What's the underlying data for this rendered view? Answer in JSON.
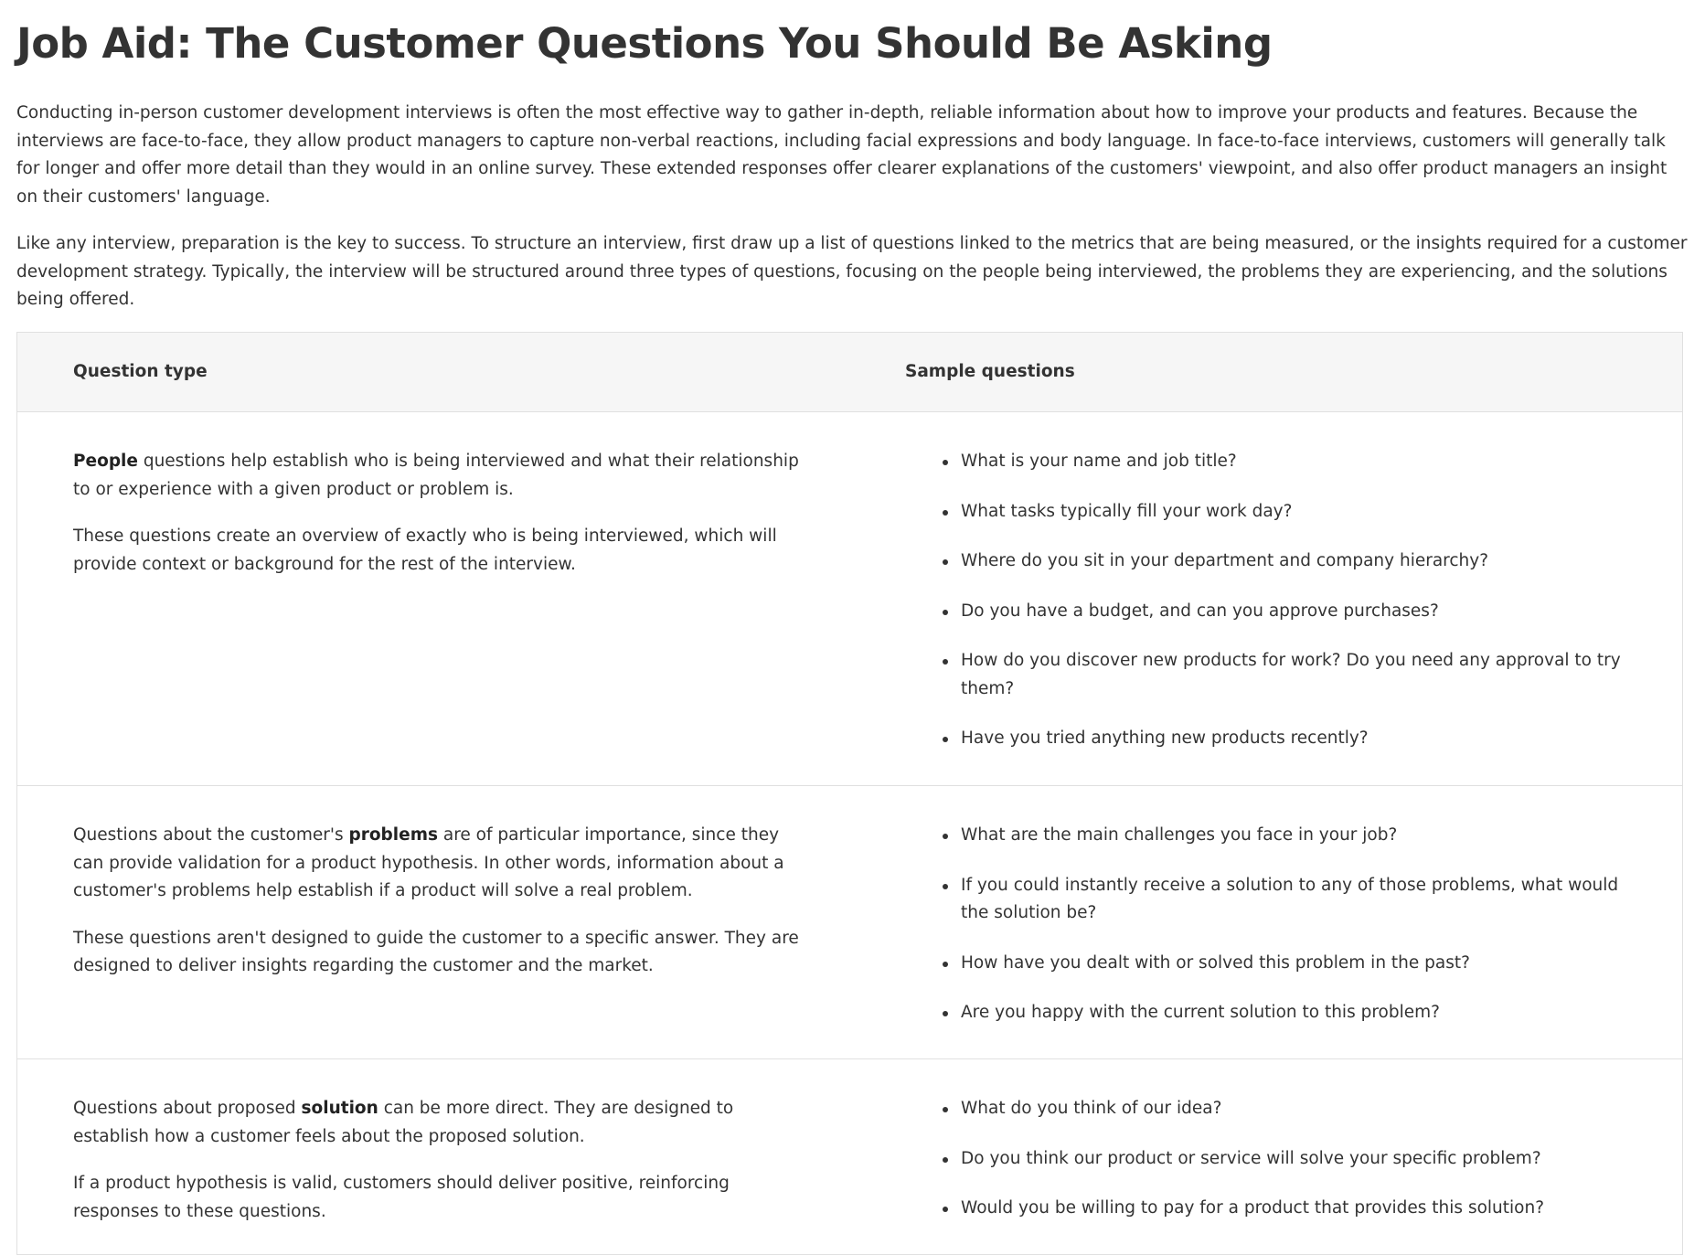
{
  "title": "Job Aid: The Customer Questions You Should Be Asking",
  "intro": [
    "Conducting in-person customer development interviews is often the most effective way to gather in-depth, reliable information about how to improve your products and features. Because the interviews are face-to-face, they allow product managers to capture non-verbal reactions, including facial expressions and body language. In face-to-face interviews, customers will generally talk for longer and offer more detail than they would in an online survey. These extended responses offer clearer explanations of the customers' viewpoint, and also offer product managers an insight on their customers' language.",
    "Like any interview, preparation is the key to success. To structure an interview, first draw up a list of questions linked to the metrics that are being measured, or the insights required for a customer development strategy. Typically, the interview will be structured around three types of questions, focusing on the people being interviewed, the problems they are experiencing, and the solutions being offered."
  ],
  "table": {
    "headers": [
      "Question type",
      "Sample questions"
    ],
    "rows": [
      {
        "p1_before": "",
        "p1_bold": "People",
        "p1_after": " questions help establish who is being interviewed and what their relationship to or experience with a given product or problem is.",
        "p2": "These questions create an overview of exactly who is being interviewed, which will provide context or background for the rest of the interview.",
        "questions": [
          "What is your name and job title?",
          "What tasks typically fill your work day?",
          "Where do you sit in your department and company hierarchy?",
          "Do you have a budget, and can you approve purchases?",
          "How do you discover new products for work? Do you need any approval to try them?",
          "Have you tried anything new products recently?"
        ]
      },
      {
        "p1_before": "Questions about the customer's ",
        "p1_bold": "problems",
        "p1_after": " are of particular importance, since they can provide validation for a product hypothesis. In other words, information about a customer's problems help establish if a product will solve a real problem.",
        "p2": "These questions aren't designed to guide the customer to a specific answer. They are designed to deliver insights regarding the customer and the market.",
        "questions": [
          "What are the main challenges you face in your job?",
          "If you could instantly receive a solution to any of those problems, what would the solution be?",
          "How have you dealt with or solved this problem in the past?",
          "Are you happy with the current solution to this problem?"
        ]
      },
      {
        "p1_before": "Questions about proposed ",
        "p1_bold": "solution",
        "p1_after": " can be more direct. They are designed to establish how a customer feels about the proposed solution.",
        "p2": "If a product hypothesis is valid, customers should deliver positive, reinforcing responses to these questions.",
        "questions": [
          "What do you think of our idea?",
          "Do you think our product or service will solve your specific problem?",
          "Would you be willing to pay for a product that provides this solution?"
        ]
      }
    ]
  }
}
